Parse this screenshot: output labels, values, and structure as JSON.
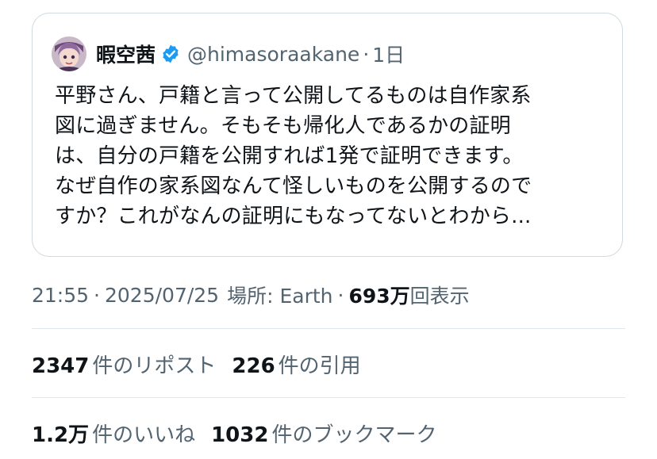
{
  "quoted_tweet": {
    "author_name": "暇空茜",
    "handle": "@himasoraakane",
    "separator": "·",
    "time_ago": "1日",
    "text_lines": [
      "平野さん、戸籍と言って公開してるものは自作家系",
      "図に過ぎません。そもそも帰化人であるかの証明",
      "は、自分の戸籍を公開すれば1発で証明できます。",
      "なぜ自作の家系図なんて怪しいものを公開するので",
      "すか？これがなんの証明にもなってないとわから..."
    ],
    "avatar_icon": "avatar-icon",
    "verified_icon": "verified-badge-icon",
    "verified_color": "#1d9bf0"
  },
  "meta": {
    "time": "21:55",
    "dot": "·",
    "date": "2025/07/25",
    "location": "場所: Earth",
    "views_number": "693万",
    "views_label": "回表示"
  },
  "stats": {
    "reposts_count": "2347",
    "reposts_label": "件のリポスト",
    "quotes_count": "226",
    "quotes_label": "件の引用",
    "likes_count": "1.2万",
    "likes_label": "件のいいね",
    "bookmarks_count": "1032",
    "bookmarks_label": "件のブックマーク"
  }
}
